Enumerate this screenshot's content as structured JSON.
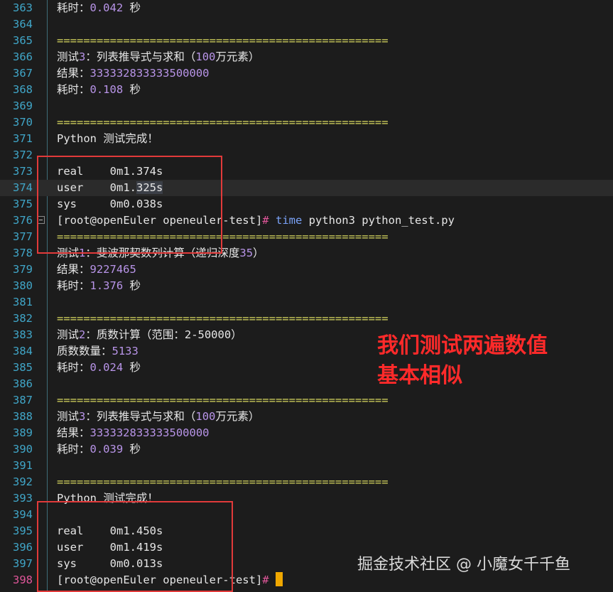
{
  "colors": {
    "background": "#1c1c1c",
    "line_number": "#40a6c8",
    "current_line_number": "#e0569a",
    "separator": "#d7d75f",
    "number": "#b894e8",
    "keyword": "#7aa2f7",
    "prompt_hash": "#e0569a",
    "cursor": "#f0a800",
    "annotation": "#ff2a2a",
    "box": "#e23a3a"
  },
  "terminal": {
    "lines": [
      {
        "n": "363",
        "seg": [
          {
            "t": "耗时：",
            "c": ""
          },
          {
            "t": "0.042",
            "c": "num"
          },
          {
            "t": " 秒",
            "c": ""
          }
        ]
      },
      {
        "n": "364",
        "seg": []
      },
      {
        "n": "365",
        "seg": [
          {
            "t": "==================================================",
            "c": "sep"
          }
        ]
      },
      {
        "n": "366",
        "seg": [
          {
            "t": "测试",
            "c": ""
          },
          {
            "t": "3",
            "c": "num"
          },
          {
            "t": "：列表推导式与求和（",
            "c": ""
          },
          {
            "t": "100",
            "c": "num"
          },
          {
            "t": "万元素）",
            "c": ""
          }
        ]
      },
      {
        "n": "367",
        "seg": [
          {
            "t": "结果：",
            "c": ""
          },
          {
            "t": "333332833333500000",
            "c": "num"
          }
        ]
      },
      {
        "n": "368",
        "seg": [
          {
            "t": "耗时：",
            "c": ""
          },
          {
            "t": "0.108",
            "c": "num"
          },
          {
            "t": " 秒",
            "c": ""
          }
        ]
      },
      {
        "n": "369",
        "seg": []
      },
      {
        "n": "370",
        "seg": [
          {
            "t": "==================================================",
            "c": "sep"
          }
        ]
      },
      {
        "n": "371",
        "seg": [
          {
            "t": "Python 测试完成！",
            "c": ""
          }
        ]
      },
      {
        "n": "372",
        "seg": []
      },
      {
        "n": "373",
        "seg": [
          {
            "t": "real    0m1.374s",
            "c": ""
          }
        ]
      },
      {
        "n": "374",
        "hl": true,
        "seg": [
          {
            "t": "user    0m1.",
            "c": ""
          },
          {
            "t": "325s",
            "c": "sel"
          }
        ]
      },
      {
        "n": "375",
        "seg": [
          {
            "t": "sys     0m0.038s",
            "c": ""
          }
        ]
      },
      {
        "n": "376",
        "seg": [
          {
            "t": "[root@openEuler openeuler-test]",
            "c": ""
          },
          {
            "t": "#",
            "c": "hash"
          },
          {
            "t": " ",
            "c": ""
          },
          {
            "t": "time",
            "c": "kw"
          },
          {
            "t": " python3 python_test.py",
            "c": ""
          }
        ]
      },
      {
        "n": "377",
        "seg": [
          {
            "t": "==================================================",
            "c": "sep"
          }
        ]
      },
      {
        "n": "378",
        "seg": [
          {
            "t": "测试",
            "c": ""
          },
          {
            "t": "1",
            "c": "num"
          },
          {
            "t": "：斐波那契数列计算（递归深度",
            "c": ""
          },
          {
            "t": "35",
            "c": "num"
          },
          {
            "t": "）",
            "c": ""
          }
        ]
      },
      {
        "n": "379",
        "seg": [
          {
            "t": "结果：",
            "c": ""
          },
          {
            "t": "9227465",
            "c": "num"
          }
        ]
      },
      {
        "n": "380",
        "seg": [
          {
            "t": "耗时：",
            "c": ""
          },
          {
            "t": "1.376",
            "c": "num"
          },
          {
            "t": " 秒",
            "c": ""
          }
        ]
      },
      {
        "n": "381",
        "seg": []
      },
      {
        "n": "382",
        "seg": [
          {
            "t": "==================================================",
            "c": "sep"
          }
        ]
      },
      {
        "n": "383",
        "seg": [
          {
            "t": "测试",
            "c": ""
          },
          {
            "t": "2",
            "c": "num"
          },
          {
            "t": "：质数计算（范围：2-50000）",
            "c": ""
          }
        ]
      },
      {
        "n": "384",
        "seg": [
          {
            "t": "质数数量：",
            "c": ""
          },
          {
            "t": "5133",
            "c": "num"
          }
        ]
      },
      {
        "n": "385",
        "seg": [
          {
            "t": "耗时：",
            "c": ""
          },
          {
            "t": "0.024",
            "c": "num"
          },
          {
            "t": " 秒",
            "c": ""
          }
        ]
      },
      {
        "n": "386",
        "seg": []
      },
      {
        "n": "387",
        "seg": [
          {
            "t": "==================================================",
            "c": "sep"
          }
        ]
      },
      {
        "n": "388",
        "seg": [
          {
            "t": "测试",
            "c": ""
          },
          {
            "t": "3",
            "c": "num"
          },
          {
            "t": "：列表推导式与求和（",
            "c": ""
          },
          {
            "t": "100",
            "c": "num"
          },
          {
            "t": "万元素）",
            "c": ""
          }
        ]
      },
      {
        "n": "389",
        "seg": [
          {
            "t": "结果：",
            "c": ""
          },
          {
            "t": "333332833333500000",
            "c": "num"
          }
        ]
      },
      {
        "n": "390",
        "seg": [
          {
            "t": "耗时：",
            "c": ""
          },
          {
            "t": "0.039",
            "c": "num"
          },
          {
            "t": " 秒",
            "c": ""
          }
        ]
      },
      {
        "n": "391",
        "seg": []
      },
      {
        "n": "392",
        "seg": [
          {
            "t": "==================================================",
            "c": "sep"
          }
        ]
      },
      {
        "n": "393",
        "seg": [
          {
            "t": "Python 测试完成！",
            "c": ""
          }
        ]
      },
      {
        "n": "394",
        "seg": []
      },
      {
        "n": "395",
        "seg": [
          {
            "t": "real    0m1.450s",
            "c": ""
          }
        ]
      },
      {
        "n": "396",
        "seg": [
          {
            "t": "user    0m1.419s",
            "c": ""
          }
        ]
      },
      {
        "n": "397",
        "seg": [
          {
            "t": "sys     0m0.013s",
            "c": ""
          }
        ]
      },
      {
        "n": "398",
        "current": true,
        "cursor": true,
        "seg": [
          {
            "t": "[root@openEuler openeuler-test]",
            "c": ""
          },
          {
            "t": "#",
            "c": "hash"
          },
          {
            "t": " ",
            "c": ""
          }
        ]
      }
    ]
  },
  "annotation": {
    "line1": "我们测试两遍数值",
    "line2": "基本相似"
  },
  "watermark": "掘金技术社区 @ 小魔女千千鱼",
  "icons": {
    "fold": "fold-collapse-icon"
  }
}
